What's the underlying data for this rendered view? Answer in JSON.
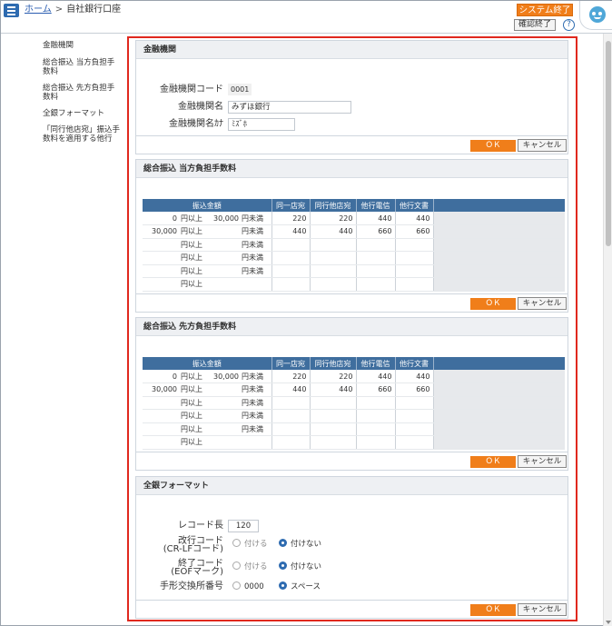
{
  "header": {
    "home_link": "ホーム",
    "separator": ">",
    "current_page": "自社銀行口座",
    "system_exit": "システム終了",
    "confirm_end": "確認終了",
    "help": "?"
  },
  "sidebar": {
    "items": [
      {
        "label": "金融機関"
      },
      {
        "label": "総合振込 当方負担手数料"
      },
      {
        "label": "総合振込 先方負担手数料"
      },
      {
        "label": "全銀フォーマット"
      },
      {
        "label": "「同行他店宛」振込手数料を適用する他行"
      }
    ]
  },
  "buttons": {
    "ok": "ＯＫ",
    "cancel": "キャンセル"
  },
  "bank": {
    "title": "金融機関",
    "code_label": "金融機関コード",
    "code_value": "0001",
    "name_label": "金融機関名",
    "name_value": "みずほ銀行",
    "kana_label": "金融機関名ｶﾅ",
    "kana_value": "ﾐｽﾞﾎ"
  },
  "fee_headers": [
    "振込金額",
    "同一店宛",
    "同行他店宛",
    "他行電信",
    "他行文書"
  ],
  "fee_ours": {
    "title": "総合振込 当方負担手数料",
    "rows": [
      {
        "from": "0",
        "ge": "円以上",
        "to": "30,000",
        "lt": "円未満",
        "same": "220",
        "other_branch": "220",
        "wire": "440",
        "doc": "440"
      },
      {
        "from": "30,000",
        "ge": "円以上",
        "to": "",
        "lt": "円未満",
        "same": "440",
        "other_branch": "440",
        "wire": "660",
        "doc": "660"
      },
      {
        "from": "",
        "ge": "円以上",
        "to": "",
        "lt": "円未満",
        "same": "",
        "other_branch": "",
        "wire": "",
        "doc": ""
      },
      {
        "from": "",
        "ge": "円以上",
        "to": "",
        "lt": "円未満",
        "same": "",
        "other_branch": "",
        "wire": "",
        "doc": ""
      },
      {
        "from": "",
        "ge": "円以上",
        "to": "",
        "lt": "円未満",
        "same": "",
        "other_branch": "",
        "wire": "",
        "doc": ""
      },
      {
        "from": "",
        "ge": "円以上",
        "to": "",
        "lt": "",
        "same": "",
        "other_branch": "",
        "wire": "",
        "doc": ""
      }
    ]
  },
  "fee_theirs": {
    "title": "総合振込 先方負担手数料",
    "rows": [
      {
        "from": "0",
        "ge": "円以上",
        "to": "30,000",
        "lt": "円未満",
        "same": "220",
        "other_branch": "220",
        "wire": "440",
        "doc": "440"
      },
      {
        "from": "30,000",
        "ge": "円以上",
        "to": "",
        "lt": "円未満",
        "same": "440",
        "other_branch": "440",
        "wire": "660",
        "doc": "660"
      },
      {
        "from": "",
        "ge": "円以上",
        "to": "",
        "lt": "円未満",
        "same": "",
        "other_branch": "",
        "wire": "",
        "doc": ""
      },
      {
        "from": "",
        "ge": "円以上",
        "to": "",
        "lt": "円未満",
        "same": "",
        "other_branch": "",
        "wire": "",
        "doc": ""
      },
      {
        "from": "",
        "ge": "円以上",
        "to": "",
        "lt": "円未満",
        "same": "",
        "other_branch": "",
        "wire": "",
        "doc": ""
      },
      {
        "from": "",
        "ge": "円以上",
        "to": "",
        "lt": "",
        "same": "",
        "other_branch": "",
        "wire": "",
        "doc": ""
      }
    ]
  },
  "zengin": {
    "title": "全銀フォーマット",
    "record_label": "レコード長",
    "record_value": "120",
    "crlf_label_1": "改行コード",
    "crlf_label_2": "(CR-LFコード)",
    "eof_label_1": "終了コード",
    "eof_label_2": "(EOFマーク)",
    "opt_attach": "付ける",
    "opt_detach": "付けない",
    "clearing_label": "手形交換所番号",
    "opt_zero": "0000",
    "opt_space": "スペース"
  }
}
